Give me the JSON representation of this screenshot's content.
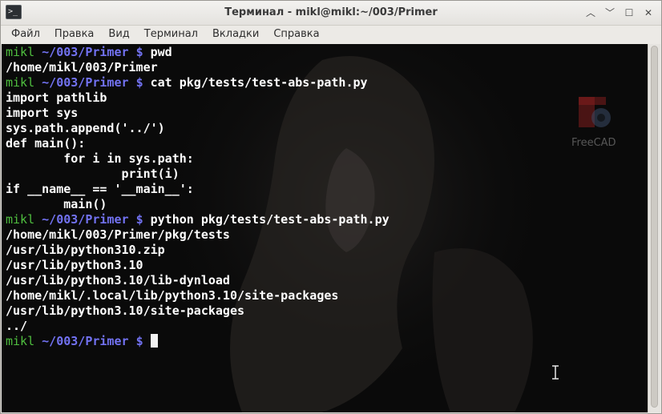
{
  "window": {
    "title": "Терминал - mikl@mikl:~/003/Primer",
    "app_icon_glyph": ">_",
    "buttons": {
      "minimize": "︿",
      "restore": "﹀",
      "maximize": "☐",
      "close": "✕"
    }
  },
  "menubar": {
    "items": [
      "Файл",
      "Правка",
      "Вид",
      "Терминал",
      "Вкладки",
      "Справка"
    ]
  },
  "terminal": {
    "prompt": {
      "user": "mikl",
      "path": "~/003/Primer",
      "sign": "$"
    },
    "lines": [
      {
        "type": "prompt",
        "cmd": "pwd"
      },
      {
        "type": "out",
        "text": "/home/mikl/003/Primer"
      },
      {
        "type": "prompt",
        "cmd": "cat pkg/tests/test-abs-path.py"
      },
      {
        "type": "out",
        "text": "import pathlib"
      },
      {
        "type": "out",
        "text": "import sys"
      },
      {
        "type": "out",
        "text": "sys.path.append('../')"
      },
      {
        "type": "out",
        "text": "def main():"
      },
      {
        "type": "out",
        "text": "        for i in sys.path:"
      },
      {
        "type": "out",
        "text": "                print(i)"
      },
      {
        "type": "out",
        "text": "if __name__ == '__main__':"
      },
      {
        "type": "out",
        "text": "        main()"
      },
      {
        "type": "prompt",
        "cmd": "python pkg/tests/test-abs-path.py"
      },
      {
        "type": "out",
        "text": "/home/mikl/003/Primer/pkg/tests"
      },
      {
        "type": "out",
        "text": "/usr/lib/python310.zip"
      },
      {
        "type": "out",
        "text": "/usr/lib/python3.10"
      },
      {
        "type": "out",
        "text": "/usr/lib/python3.10/lib-dynload"
      },
      {
        "type": "out",
        "text": "/home/mikl/.local/lib/python3.10/site-packages"
      },
      {
        "type": "out",
        "text": "/usr/lib/python3.10/site-packages"
      },
      {
        "type": "out",
        "text": "../"
      },
      {
        "type": "prompt",
        "cmd": "",
        "cursor": true
      }
    ],
    "desktop_icon_label": "FreeCAD"
  },
  "colors": {
    "prompt_user": "#4fbf3f",
    "prompt_path": "#7272f2",
    "text": "#ffffff",
    "terminal_bg": "#0a0a0a"
  }
}
